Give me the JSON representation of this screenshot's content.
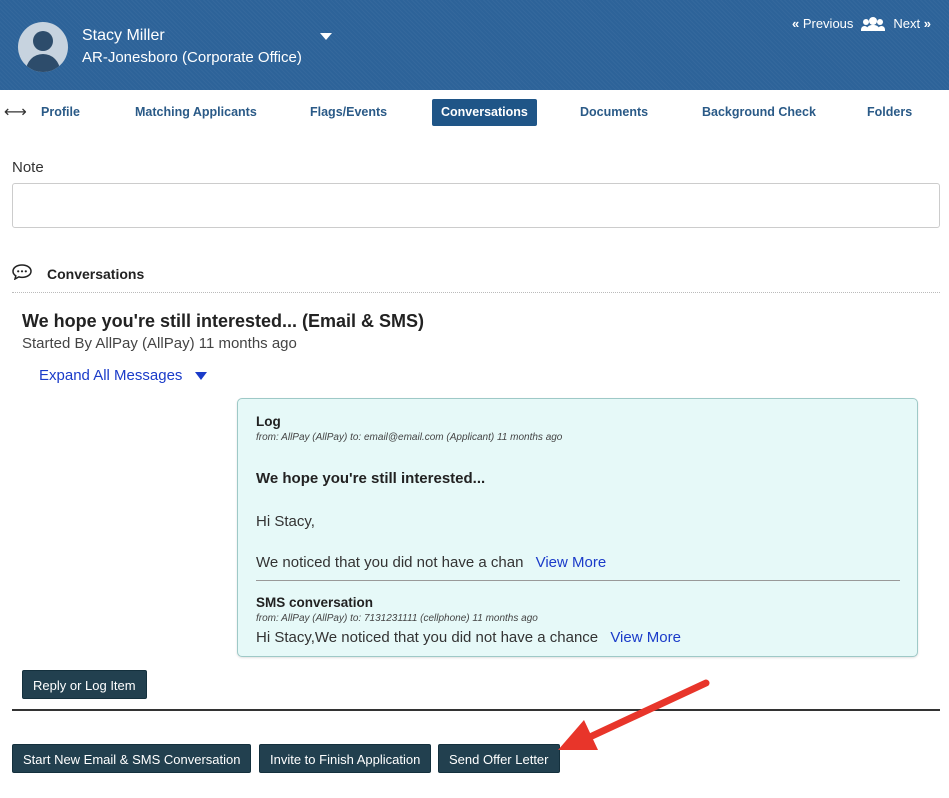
{
  "header": {
    "name": "Stacy Miller",
    "location": "AR-Jonesboro (Corporate Office)",
    "previous_label": "Previous",
    "next_label": "Next",
    "background_color": "#2d6399"
  },
  "tabs": [
    {
      "label": "Profile",
      "active": false
    },
    {
      "label": "Matching Applicants",
      "active": false
    },
    {
      "label": "Flags/Events",
      "active": false
    },
    {
      "label": "Conversations",
      "active": true
    },
    {
      "label": "Documents",
      "active": false
    },
    {
      "label": "Background Check",
      "active": false
    },
    {
      "label": "Folders",
      "active": false
    }
  ],
  "note": {
    "label": "Note",
    "value": ""
  },
  "conversations": {
    "section_title": "Conversations",
    "thread_title": "We hope you're still interested... (Email & SMS)",
    "started_by": "Started By AllPay (AllPay) 11 months ago",
    "expand_label": "Expand All Messages",
    "message": {
      "type_label": "Log",
      "from_line": "from: AllPay (AllPay) to: email@email.com (Applicant) 11 months ago",
      "subject": "We hope you're still interested...",
      "greeting": "Hi Stacy,",
      "snippet": "We noticed that you did not have a chan",
      "view_more": "View More",
      "sms_title": "SMS conversation",
      "sms_from_line": "from: AllPay (AllPay) to: 7131231111 (cellphone) 11 months ago",
      "sms_snippet": "Hi Stacy,We noticed that you did not have a chance",
      "sms_view_more": "View More",
      "card_color": "#e6f9f8"
    }
  },
  "actions": {
    "reply_label": "Reply or Log Item",
    "start_new_label": "Start New Email & SMS Conversation",
    "invite_label": "Invite to Finish Application",
    "offer_label": "Send Offer Letter",
    "button_color": "#22404f"
  },
  "annotation": {
    "arrow_color": "#e8352a"
  }
}
